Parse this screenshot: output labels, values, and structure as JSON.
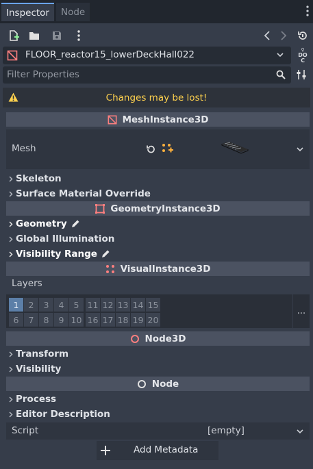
{
  "tabs": [
    {
      "label": "Inspector"
    },
    {
      "label": "Node"
    }
  ],
  "toolbar": {
    "icons": [
      "new-resource-icon",
      "load-resource-icon",
      "save-resource-icon",
      "more-options-icon",
      "history-back-icon",
      "history-forward-icon",
      "object-history-icon"
    ]
  },
  "node_path": {
    "text": "FLOOR_reactor15_lowerDeckHall022",
    "doc_label_top": "DO",
    "doc_label_bottom": "C"
  },
  "filter": {
    "placeholder": "Filter Properties"
  },
  "warning": {
    "text": "Changes may be lost!"
  },
  "colors": {
    "accent": "#6aa4ff",
    "warning": "#ffd24e",
    "mesh_icon": "#fc7f7f",
    "selected_layer": "#5c7fa8"
  },
  "sections": {
    "mesh_instance": {
      "title": "MeshInstance3D",
      "mesh_label": "Mesh",
      "groups": [
        "Skeleton",
        "Surface Material Override"
      ]
    },
    "geometry_instance": {
      "title": "GeometryInstance3D",
      "groups": [
        "Geometry",
        "Global Illumination",
        "Visibility Range"
      ]
    },
    "visual_instance": {
      "title": "VisualInstance3D",
      "layers_label": "Layers",
      "layers_row1": [
        "1",
        "2",
        "3",
        "4",
        "5",
        "11",
        "12",
        "13",
        "14",
        "15"
      ],
      "layers_row2": [
        "6",
        "7",
        "8",
        "9",
        "10",
        "16",
        "17",
        "18",
        "19",
        "20"
      ],
      "selected_layer": "1",
      "more_label": "..."
    },
    "node3d": {
      "title": "Node3D",
      "groups": [
        "Transform",
        "Visibility"
      ]
    },
    "node": {
      "title": "Node",
      "groups": [
        "Process",
        "Editor Description"
      ]
    }
  },
  "script": {
    "label": "Script",
    "value": "[empty]"
  },
  "add_metadata": {
    "label": "Add Metadata"
  }
}
